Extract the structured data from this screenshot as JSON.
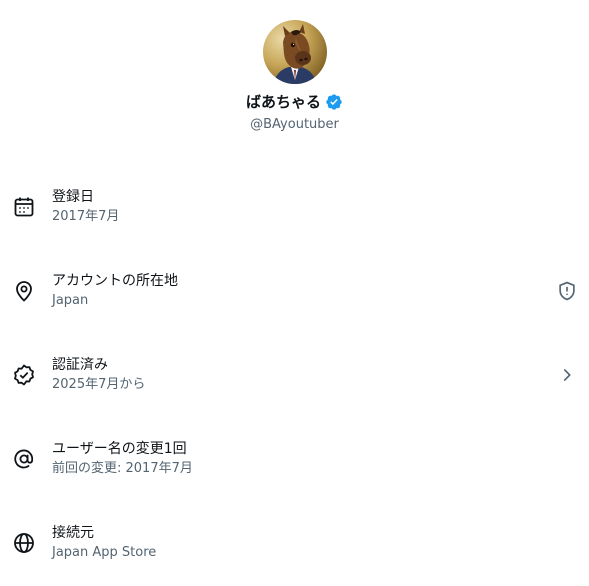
{
  "profile": {
    "display_name": "ばあちゃる",
    "handle": "@BAyoutuber",
    "avatar_icon": "horse-mask-avatar",
    "verified_icon": "verified-badge-icon",
    "verified_color": "#1d9bf0"
  },
  "rows": [
    {
      "icon": "calendar-icon",
      "title": "登録日",
      "subtitle": "2017年7月"
    },
    {
      "icon": "location-pin-icon",
      "title": "アカウントの所在地",
      "subtitle": "Japan",
      "trailing_icon": "shield-alert-icon"
    },
    {
      "icon": "verified-check-icon",
      "title": "認証済み",
      "subtitle": "2025年7月から",
      "trailing_icon": "chevron-right-icon"
    },
    {
      "icon": "at-sign-icon",
      "title": "ユーザー名の変更1回",
      "subtitle": "前回の変更: 2017年7月"
    },
    {
      "icon": "globe-icon",
      "title": "接続元",
      "subtitle": "Japan App Store"
    }
  ],
  "colors": {
    "text_primary": "#0f1419",
    "text_secondary": "#536471"
  }
}
